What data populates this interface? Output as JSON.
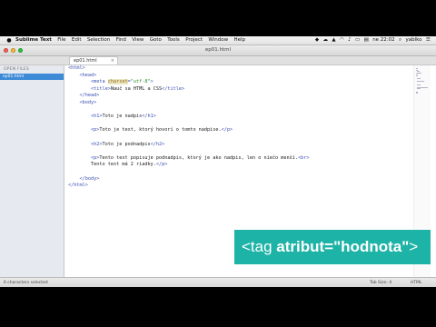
{
  "menubar": {
    "app_name": "Sublime Text",
    "items": [
      "File",
      "Edit",
      "Selection",
      "Find",
      "View",
      "Goto",
      "Tools",
      "Project",
      "Window",
      "Help"
    ],
    "clock": "ne 22:02",
    "user": "yablko"
  },
  "window": {
    "title": "ep01.html"
  },
  "tab": {
    "label": "ep01.html",
    "close_glyph": "×"
  },
  "sidebar": {
    "header": "OPEN FILES",
    "file": "ep01.html"
  },
  "code_lines": [
    [
      [
        "tag",
        "<html>"
      ]
    ],
    [
      [
        "txt",
        "    "
      ],
      [
        "tag",
        "<head>"
      ]
    ],
    [
      [
        "txt",
        "        "
      ],
      [
        "tag",
        "<meta "
      ],
      [
        "attr",
        "charset"
      ],
      [
        "tag",
        "="
      ],
      [
        "str",
        "\"utf-8\""
      ],
      [
        "tag",
        ">"
      ]
    ],
    [
      [
        "txt",
        "        "
      ],
      [
        "tag",
        "<title>"
      ],
      [
        "txt",
        "Nauč sa HTML a CSS"
      ],
      [
        "tag",
        "</title>"
      ]
    ],
    [
      [
        "txt",
        "    "
      ],
      [
        "tag",
        "</head>"
      ]
    ],
    [
      [
        "txt",
        "    "
      ],
      [
        "tag",
        "<body>"
      ]
    ],
    [
      [
        "txt",
        ""
      ]
    ],
    [
      [
        "txt",
        "        "
      ],
      [
        "tag",
        "<h1>"
      ],
      [
        "txt",
        "Toto je nadpis"
      ],
      [
        "tag",
        "</h1>"
      ]
    ],
    [
      [
        "txt",
        ""
      ]
    ],
    [
      [
        "txt",
        "        "
      ],
      [
        "tag",
        "<p>"
      ],
      [
        "txt",
        "Toto je text, ktorý hovorí o tomto nadpise."
      ],
      [
        "tag",
        "</p>"
      ]
    ],
    [
      [
        "txt",
        ""
      ]
    ],
    [
      [
        "txt",
        "        "
      ],
      [
        "tag",
        "<h2>"
      ],
      [
        "txt",
        "Toto je podnadpis"
      ],
      [
        "tag",
        "</h2>"
      ]
    ],
    [
      [
        "txt",
        ""
      ]
    ],
    [
      [
        "txt",
        "        "
      ],
      [
        "tag",
        "<p>"
      ],
      [
        "txt",
        "Tento text popisuje podnadpis, ktorý je ako nadpis, len o niečo menší."
      ],
      [
        "tag",
        "<br>"
      ]
    ],
    [
      [
        "txt",
        "        Tento text má 2 riadky."
      ],
      [
        "tag",
        "</p>"
      ]
    ],
    [
      [
        "txt",
        ""
      ]
    ],
    [
      [
        "txt",
        "    "
      ],
      [
        "tag",
        "</body>"
      ]
    ],
    [
      [
        "tag",
        "</html>"
      ]
    ]
  ],
  "statusbar": {
    "selection": "6 characters selected",
    "tab_size": "Tab Size: 4",
    "syntax": "HTML"
  },
  "overlay": {
    "open": "<tag ",
    "attr": "atribut=\"hodnota\"",
    "close": ">"
  },
  "colors": {
    "overlay_bg": "#1eb3a7",
    "sidebar_selected": "#3d8bd6",
    "tag": "#3b4fb0",
    "attribute": "#9c6a17",
    "string": "#2a8a2a"
  }
}
